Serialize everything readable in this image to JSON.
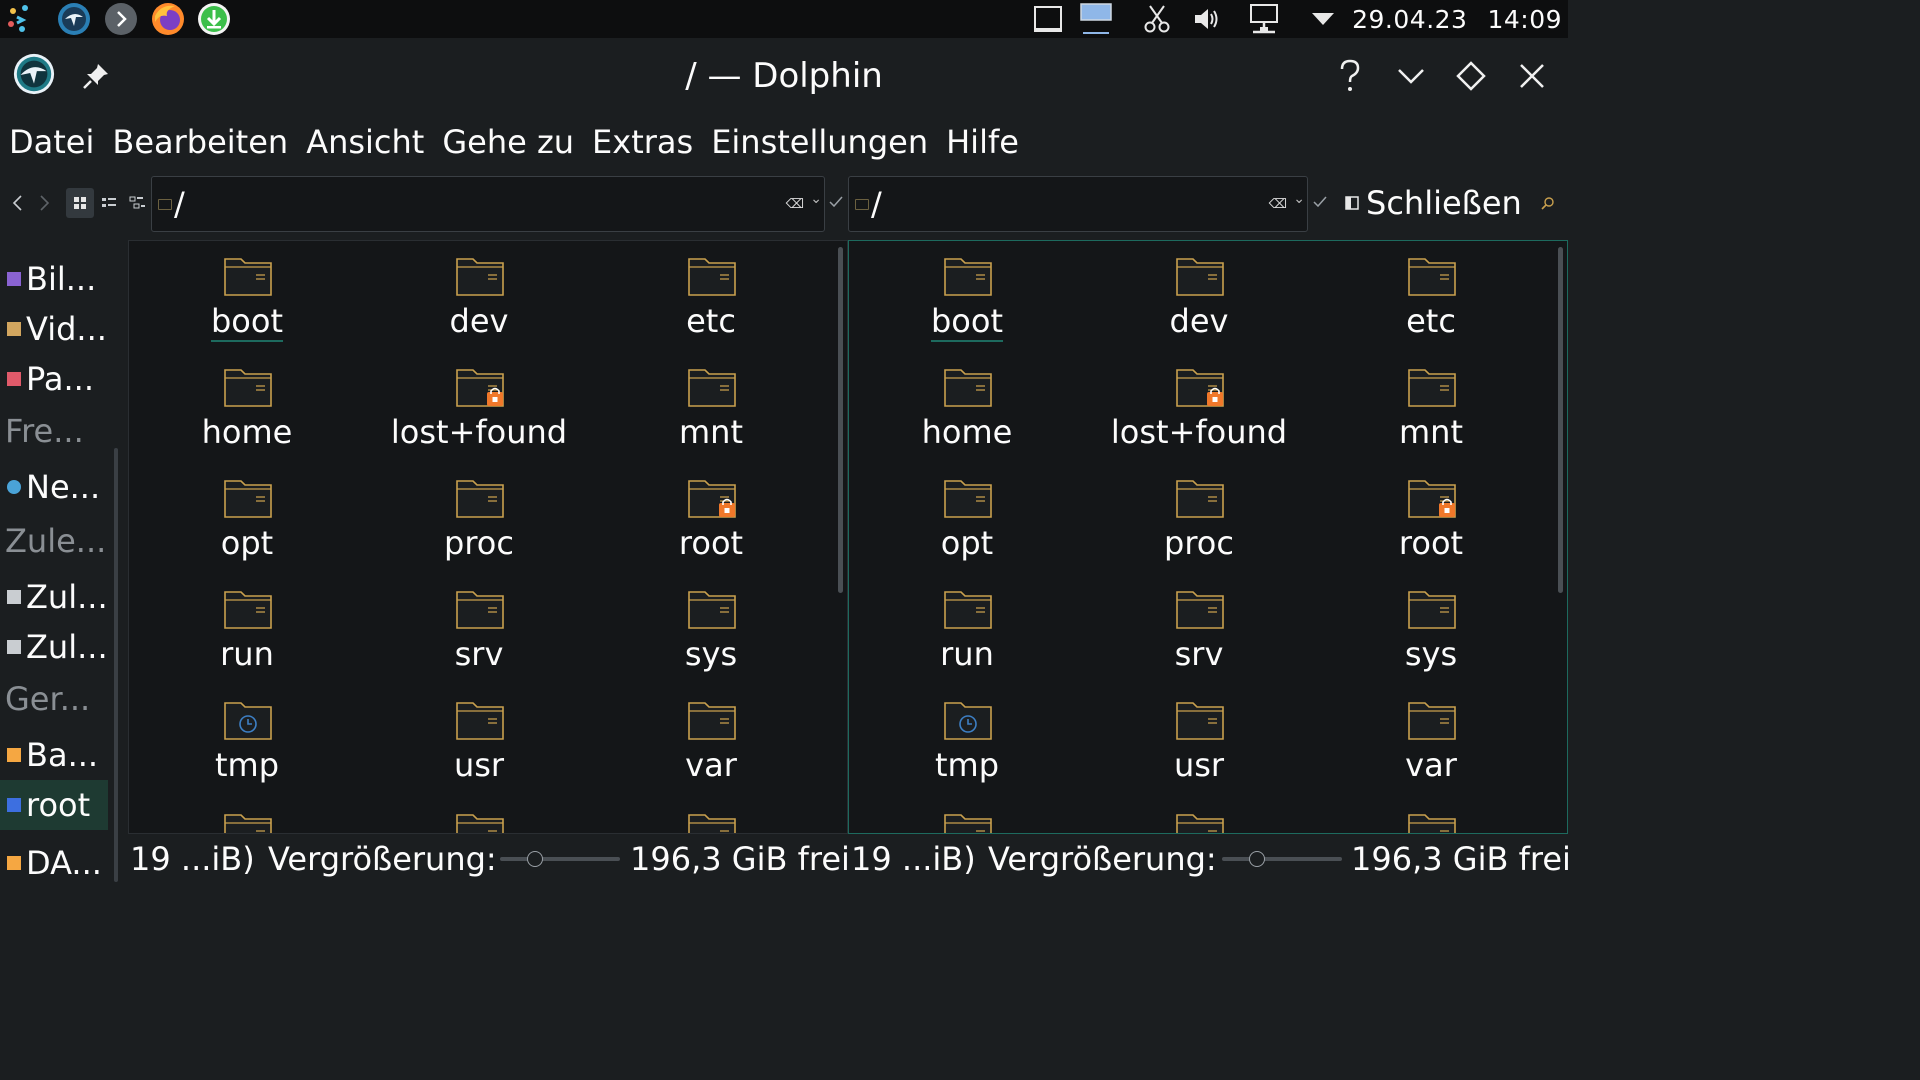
{
  "system_tray": {
    "date": "29.04.23",
    "time": "14:09",
    "launchers": [
      "dolphin-icon",
      "chevron-right-icon",
      "firefox-icon",
      "download-icon"
    ],
    "tray_icons": [
      "window-icon",
      "screen-icon",
      "scissors-icon",
      "volume-icon",
      "network-icon",
      "caret-down-icon"
    ]
  },
  "window": {
    "title": "/ — Dolphin"
  },
  "menubar": {
    "items": [
      "Datei",
      "Bearbeiten",
      "Ansicht",
      "Gehe zu",
      "Extras",
      "Einstellungen",
      "Hilfe"
    ]
  },
  "toolbar": {
    "left_path": "/",
    "right_path": "/",
    "close_label": "Schließen"
  },
  "sidebar": {
    "places": [
      {
        "label": "Bil...",
        "icon": "pictures-icon",
        "color": "#8a63d2"
      },
      {
        "label": "Vid...",
        "icon": "videos-icon",
        "color": "#d2a65f"
      },
      {
        "label": "Pa...",
        "icon": "trash-icon",
        "color": "#e05a6a"
      }
    ],
    "sections": [
      "Fre...",
      "Zule...",
      "Ger..."
    ],
    "remote": [
      {
        "label": "Ne...",
        "icon": "network-icon",
        "color": "#4aa3d8"
      }
    ],
    "recent": [
      {
        "label": "Zul...",
        "icon": "recent-files-icon",
        "color": "#c9cdd1"
      },
      {
        "label": "Zul...",
        "icon": "recent-locations-icon",
        "color": "#c9cdd1"
      }
    ],
    "devices": [
      {
        "label": "Ba...",
        "icon": "drive-icon",
        "color": "#f5a742"
      },
      {
        "label": "root",
        "icon": "root-drive-icon",
        "color": "#3d6fe0"
      },
      {
        "label": "DA...",
        "icon": "drive-icon",
        "color": "#f5a742"
      }
    ]
  },
  "folders": [
    {
      "name": "boot",
      "locked": false,
      "kind": "folder"
    },
    {
      "name": "dev",
      "locked": false,
      "kind": "folder"
    },
    {
      "name": "etc",
      "locked": false,
      "kind": "folder"
    },
    {
      "name": "home",
      "locked": false,
      "kind": "folder"
    },
    {
      "name": "lost+found",
      "locked": true,
      "kind": "folder"
    },
    {
      "name": "mnt",
      "locked": false,
      "kind": "folder"
    },
    {
      "name": "opt",
      "locked": false,
      "kind": "folder"
    },
    {
      "name": "proc",
      "locked": false,
      "kind": "folder"
    },
    {
      "name": "root",
      "locked": true,
      "kind": "folder"
    },
    {
      "name": "run",
      "locked": false,
      "kind": "folder"
    },
    {
      "name": "srv",
      "locked": false,
      "kind": "folder"
    },
    {
      "name": "sys",
      "locked": false,
      "kind": "folder"
    },
    {
      "name": "tmp",
      "locked": false,
      "kind": "temp"
    },
    {
      "name": "usr",
      "locked": false,
      "kind": "folder"
    },
    {
      "name": "var",
      "locked": false,
      "kind": "folder"
    }
  ],
  "status": {
    "left_info": "19 ...iB)",
    "right_info": "19 ...iB)",
    "zoom_label": "Vergrößerung:",
    "free_space": "196,3 GiB frei",
    "zoom_level": 0.28
  },
  "colors": {
    "accent": "#1d6a5e",
    "folder_outline": "#c9a04e",
    "lock": "#f0782a",
    "temp_folder": "#3d7fc4"
  }
}
